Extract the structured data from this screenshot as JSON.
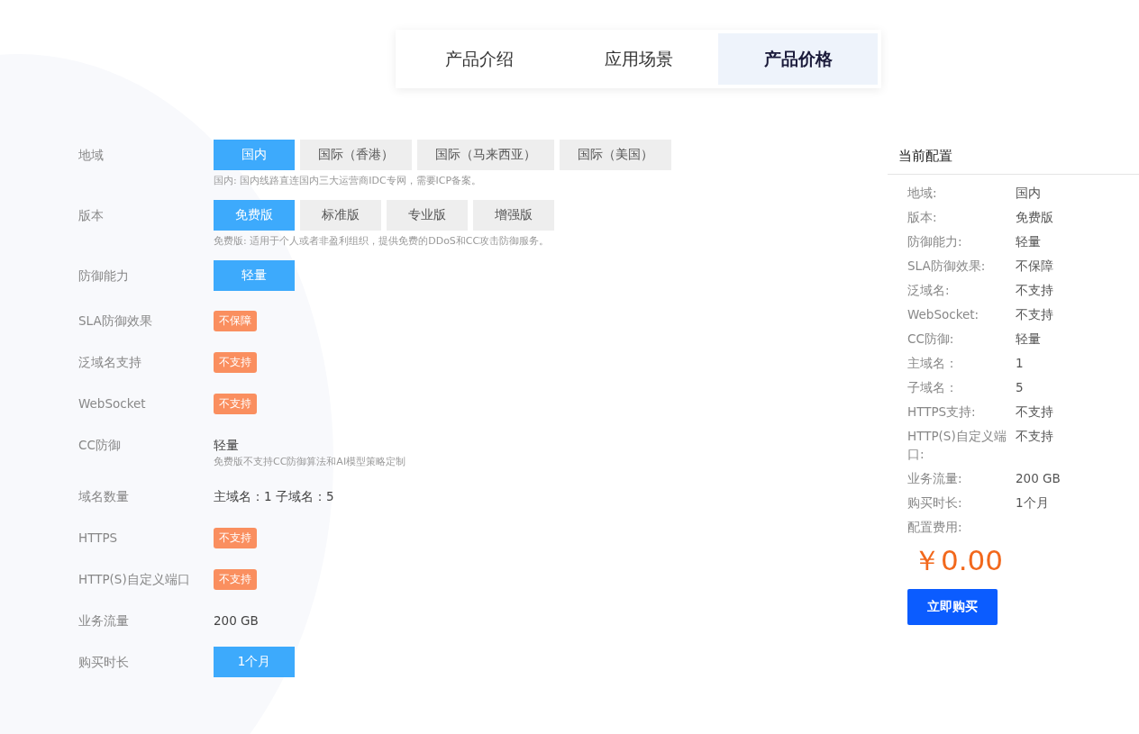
{
  "tabs": [
    {
      "label": "产品介绍",
      "selected": false
    },
    {
      "label": "应用场景",
      "selected": false
    },
    {
      "label": "产品价格",
      "selected": true
    }
  ],
  "form": [
    {
      "label": "地域",
      "kind": "options",
      "options": [
        {
          "label": "国内",
          "selected": true
        },
        {
          "label": "国际（香港）",
          "selected": false
        },
        {
          "label": "国际（马来西亚）",
          "selected": false
        },
        {
          "label": "国际（美国）",
          "selected": false
        }
      ],
      "note": "国内: 国内线路直连国内三大运营商IDC专网，需要ICP备案。"
    },
    {
      "label": "版本",
      "kind": "options",
      "options": [
        {
          "label": "免费版",
          "selected": true
        },
        {
          "label": "标准版",
          "selected": false
        },
        {
          "label": "专业版",
          "selected": false
        },
        {
          "label": "增强版",
          "selected": false
        }
      ],
      "note": "免费版: 适用于个人或者非盈利组织，提供免费的DDoS和CC攻击防御服务。"
    },
    {
      "label": "防御能力",
      "kind": "options",
      "options": [
        {
          "label": "轻量",
          "selected": true
        }
      ]
    },
    {
      "label": "SLA防御效果",
      "kind": "badge",
      "value": "不保障"
    },
    {
      "label": "泛域名支持",
      "kind": "badge",
      "value": "不支持"
    },
    {
      "label": "WebSocket",
      "kind": "badge",
      "value": "不支持"
    },
    {
      "label": "CC防御",
      "kind": "text",
      "value": "轻量",
      "note": "免费版不支持CC防御算法和AI模型策略定制"
    },
    {
      "label": "域名数量",
      "kind": "text",
      "value": "主域名：1 子域名：5"
    },
    {
      "label": "HTTPS",
      "kind": "badge",
      "value": "不支持"
    },
    {
      "label": "HTTP(S)自定义端口",
      "kind": "badge",
      "value": "不支持"
    },
    {
      "label": "业务流量",
      "kind": "text",
      "value": "200 GB"
    },
    {
      "label": "购买时长",
      "kind": "options",
      "options": [
        {
          "label": "1个月",
          "selected": true
        }
      ]
    }
  ],
  "summary": {
    "title": "当前配置",
    "items": [
      {
        "label": "地域:",
        "value": "国内"
      },
      {
        "label": "版本:",
        "value": "免费版"
      },
      {
        "label": "防御能力:",
        "value": "轻量"
      },
      {
        "label": "SLA防御效果:",
        "value": "不保障"
      },
      {
        "label": "泛域名:",
        "value": "不支持"
      },
      {
        "label": "WebSocket:",
        "value": "不支持"
      },
      {
        "label": "CC防御:",
        "value": "轻量"
      },
      {
        "label": "主域名：",
        "value": "1"
      },
      {
        "label": "子域名：",
        "value": "5"
      },
      {
        "label": "HTTPS支持:",
        "value": "不支持"
      },
      {
        "label": "HTTP(S)自定义端口:",
        "value": "不支持"
      },
      {
        "label": "业务流量:",
        "value": "200 GB"
      },
      {
        "label": "购买时长:",
        "value": "1个月"
      }
    ],
    "price_label": "配置费用:",
    "price": "￥0.00",
    "buy_button": "立即购买"
  }
}
